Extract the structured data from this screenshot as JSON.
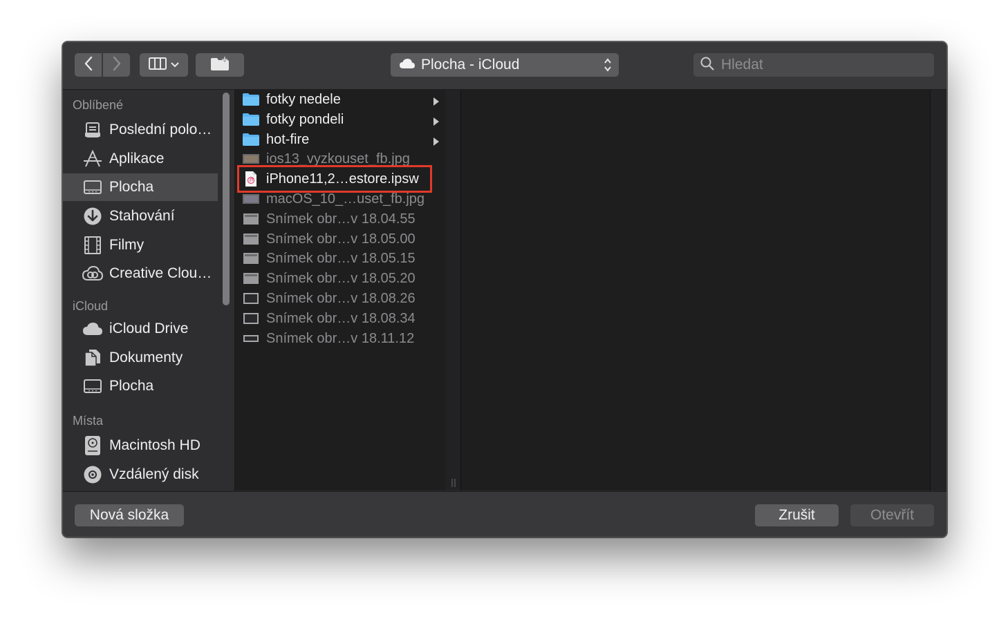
{
  "toolbar": {
    "path_label": "Plocha - iCloud",
    "search_placeholder": "Hledat"
  },
  "sidebar": {
    "sections": [
      {
        "title": "Oblíbené"
      },
      {
        "title": "iCloud"
      },
      {
        "title": "Místa"
      }
    ],
    "favorites": [
      {
        "label": "Poslední polo…",
        "icon": "recents-icon"
      },
      {
        "label": "Aplikace",
        "icon": "applications-icon"
      },
      {
        "label": "Plocha",
        "icon": "desktop-icon",
        "selected": true
      },
      {
        "label": "Stahování",
        "icon": "downloads-icon"
      },
      {
        "label": "Filmy",
        "icon": "movies-icon"
      },
      {
        "label": "Creative Clou…",
        "icon": "creative-cloud-icon"
      }
    ],
    "icloud": [
      {
        "label": "iCloud Drive",
        "icon": "cloud-icon"
      },
      {
        "label": "Dokumenty",
        "icon": "documents-icon"
      },
      {
        "label": "Plocha",
        "icon": "desktop-icon"
      }
    ],
    "places": [
      {
        "label": "Macintosh HD",
        "icon": "hard-disk-icon"
      },
      {
        "label": "Vzdálený disk",
        "icon": "remote-disc-icon"
      }
    ]
  },
  "files": [
    {
      "name": "fotky nedele",
      "type": "folder"
    },
    {
      "name": "fotky pondeli",
      "type": "folder"
    },
    {
      "name": "hot-fire",
      "type": "folder"
    },
    {
      "name": "ios13_vyzkouset_fb.jpg",
      "type": "image",
      "dimmed": true
    },
    {
      "name": "iPhone11,2…estore.ipsw",
      "type": "ipsw",
      "highlighted": true
    },
    {
      "name": "macOS_10_…uset_fb.jpg",
      "type": "image",
      "dimmed": true
    },
    {
      "name": "Snímek obr…v 18.04.55",
      "type": "screenshot",
      "dimmed": true
    },
    {
      "name": "Snímek obr…v 18.05.00",
      "type": "screenshot",
      "dimmed": true
    },
    {
      "name": "Snímek obr…v 18.05.15",
      "type": "screenshot",
      "dimmed": true
    },
    {
      "name": "Snímek obr…v 18.05.20",
      "type": "screenshot",
      "dimmed": true
    },
    {
      "name": "Snímek obr…v 18.08.26",
      "type": "screenshot-dark",
      "dimmed": true
    },
    {
      "name": "Snímek obr…v 18.08.34",
      "type": "screenshot-dark",
      "dimmed": true
    },
    {
      "name": "Snímek obr…v 18.11.12",
      "type": "screenshot-wide",
      "dimmed": true
    }
  ],
  "buttons": {
    "new_folder": "Nová složka",
    "cancel": "Zrušit",
    "open": "Otevřít"
  },
  "colors": {
    "highlight_border": "#e23a2a",
    "folder_blue": "#5ab3f0"
  }
}
